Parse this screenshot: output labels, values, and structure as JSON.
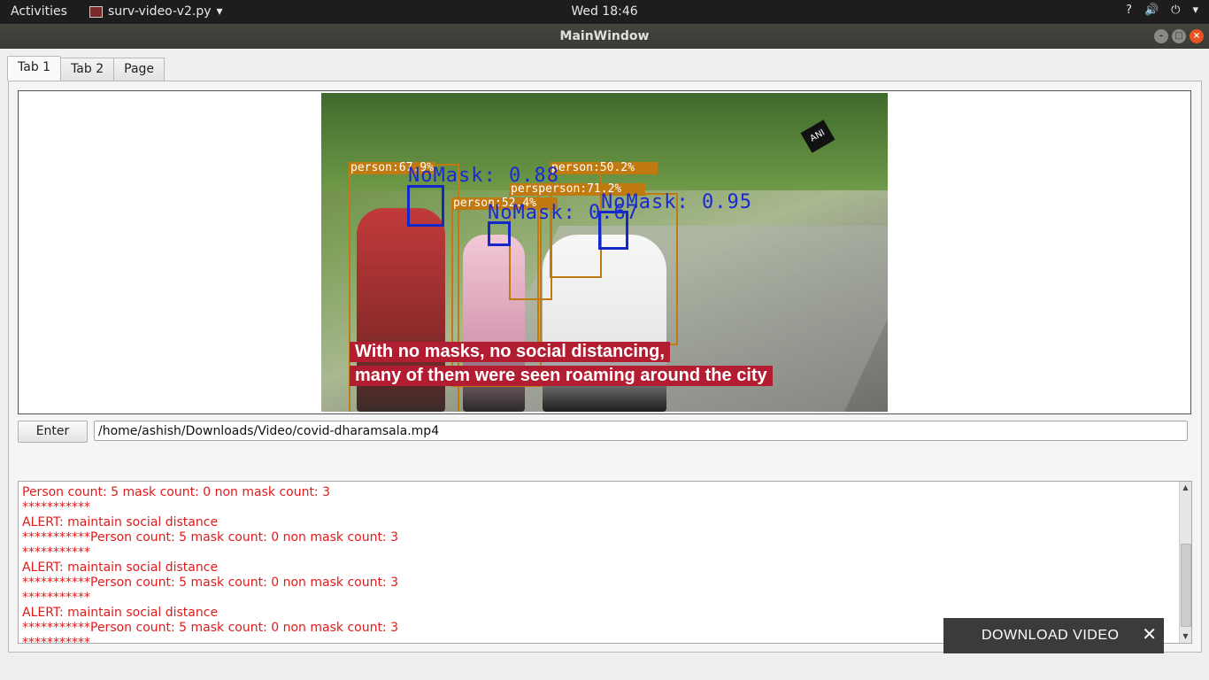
{
  "topbar": {
    "activities": "Activities",
    "app_name": "surv-video-v2.py",
    "app_caret": "▾",
    "clock": "Wed 18:46",
    "help": "?",
    "volume": "🔊",
    "power": "⏻",
    "menu_caret": "▾"
  },
  "window": {
    "title": "MainWindow",
    "minimize": "–",
    "maximize": "□",
    "close": "×"
  },
  "tabs": [
    {
      "label": "Tab 1"
    },
    {
      "label": "Tab 2"
    },
    {
      "label": "Page"
    }
  ],
  "video": {
    "caption_line1": "With no masks, no social distancing,",
    "caption_line2": "many of them were seen roaming around the city",
    "logo_text": "ANI",
    "detections": [
      {
        "label": "person:67.9%"
      },
      {
        "label": "person:50.2%"
      },
      {
        "label": "persperson:71.2%"
      },
      {
        "label": "person:52.4%"
      }
    ],
    "mask_labels": [
      {
        "label": "NoMask: 0.88"
      },
      {
        "label": "NoMask: 0.67"
      },
      {
        "label": "NoMask: 0.95"
      }
    ]
  },
  "controls": {
    "enter_label": "Enter",
    "path_value": "/home/ashish/Downloads/Video/covid-dharamsala.mp4"
  },
  "log_lines": [
    "Person count: 5 mask count: 0 non mask count: 3",
    "***********",
    "ALERT: maintain social distance",
    "***********Person count: 5 mask count: 0 non mask count: 3",
    "***********",
    "ALERT: maintain social distance",
    "***********Person count: 5 mask count: 0 non mask count: 3",
    "***********",
    "ALERT: maintain social distance",
    "***********Person count: 5 mask count: 0 non mask count: 3",
    "***********"
  ],
  "scrollbar": {
    "up": "▲",
    "down": "▼"
  },
  "download": {
    "label": "DOWNLOAD VIDEO",
    "close": "✕"
  },
  "colors": {
    "log_text": "#e01b1b",
    "detection_box": "#c07a0f",
    "face_box": "#1428c8",
    "close_button": "#e95420"
  }
}
